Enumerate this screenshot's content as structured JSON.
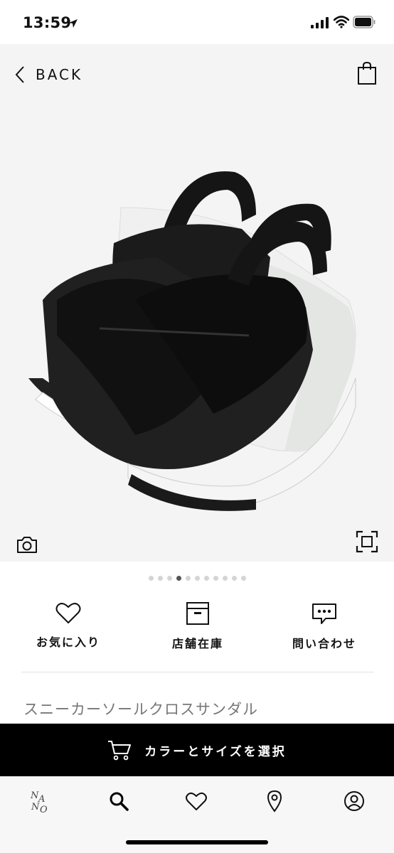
{
  "status_bar": {
    "time": "13:59"
  },
  "header": {
    "back_label": "BACK"
  },
  "gallery": {
    "image_count": 11,
    "active_index": 3
  },
  "actions": [
    {
      "label": "お気に入り",
      "icon": "heart-icon"
    },
    {
      "label": "店舗在庫",
      "icon": "store-box-icon"
    },
    {
      "label": "問い合わせ",
      "icon": "chat-bubble-icon"
    }
  ],
  "product": {
    "name": "スニーカーソールクロスサンダル"
  },
  "cta": {
    "label": "カラーとサイズを選択",
    "icon": "cart-icon"
  },
  "tabbar": [
    {
      "name": "home",
      "icon": "brand-logo-icon"
    },
    {
      "name": "search",
      "icon": "search-icon"
    },
    {
      "name": "favorites",
      "icon": "heart-icon"
    },
    {
      "name": "stores",
      "icon": "location-pin-icon"
    },
    {
      "name": "account",
      "icon": "user-icon"
    }
  ],
  "colors": {
    "cta_bg": "#000000",
    "hero_bg": "#f4f4f5",
    "tabbar_bg": "#f7f7f7"
  }
}
